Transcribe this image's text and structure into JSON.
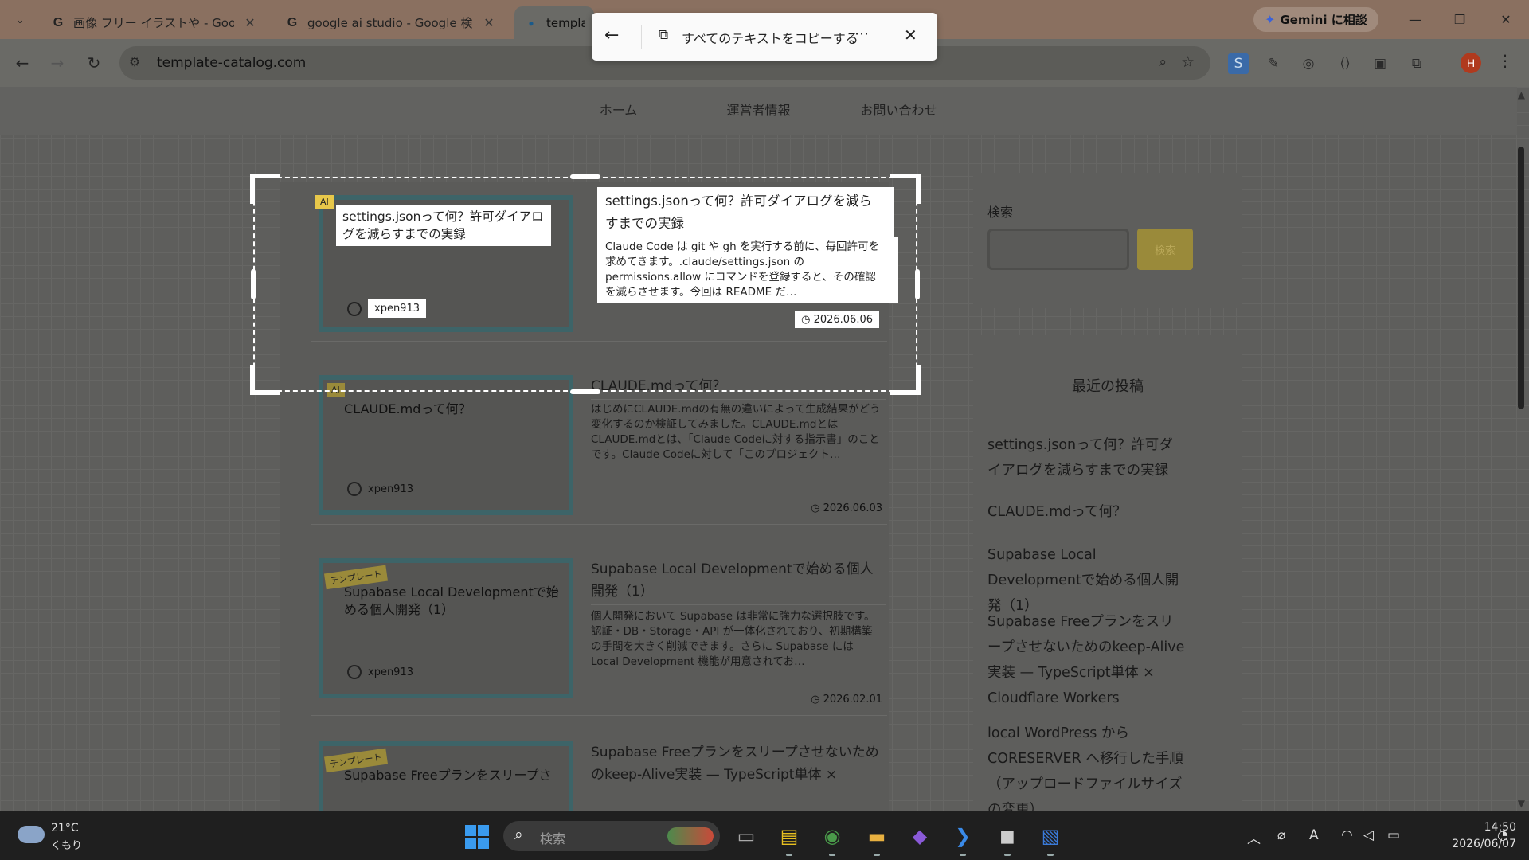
{
  "browser": {
    "tabs": [
      {
        "title": "画像 フリー イラストや - Google 検",
        "icon": "G"
      },
      {
        "title": "google ai studio - Google 検索",
        "icon": "G"
      },
      {
        "title": "template",
        "icon": "●"
      }
    ],
    "gemini_label": "Gemini に相談",
    "url": "template-catalog.com"
  },
  "capture_bar": {
    "copy_label": "すべてのテキストをコピーする"
  },
  "site_nav": [
    "ホーム",
    "運営者情報",
    "お問い合わせ"
  ],
  "posts": [
    {
      "category": "AI",
      "thumb_title": "settings.jsonって何？許可ダイアログを減らすまでの実録",
      "author": "xpen913",
      "title_line1": "settings.jsonって何？許可ダイアログを減ら",
      "title_line2": "すまでの実録",
      "excerpt": [
        "Claude Code は git や gh を実行する前に、毎回許可を",
        "求めてきます。.claude/settings.json の",
        "permissions.allow にコマンドを登録すると、その確認",
        "を減らさせます。今回は README だ…"
      ],
      "date": "2026.06.06"
    },
    {
      "category": "AI",
      "thumb_title": "CLAUDE.mdって何？",
      "author": "xpen913",
      "title": "CLAUDE.mdって何？",
      "excerpt": "はじめにCLAUDE.mdの有無の違いによって生成結果がどう変化するのか検証してみました。CLAUDE.mdとはCLAUDE.mdとは、「Claude Codeに対する指示書」のことです。Claude Codeに対して「このプロジェクト…",
      "date": "2026.06.03"
    },
    {
      "category": "テンプレート",
      "thumb_title": "Supabase Local Developmentで始める個人開発（1）",
      "author": "xpen913",
      "title": "Supabase Local Developmentで始める個人開発（1）",
      "excerpt": "個人開発において Supabase は非常に強力な選択肢です。認証・DB・Storage・API が一体化されており、初期構築の手間を大きく削減できます。さらに Supabase には Local Development 機能が用意されてお…",
      "date": "2026.02.01"
    },
    {
      "category": "テンプレート",
      "thumb_title": "Supabase Freeプランをスリープさ",
      "title": "Supabase Freeプランをスリープさせないためのkeep-Alive実装 — TypeScript単体 ×"
    }
  ],
  "sidebar": {
    "search_label": "検索",
    "search_button": "検索",
    "recent_heading": "最近の投稿",
    "recent": [
      "settings.jsonって何？許可ダイアログを減らすまでの実録",
      "CLAUDE.mdって何？",
      "Supabase Local Developmentで始める個人開発（1）",
      "Supabase Freeプランをスリープさせないためのkeep-Alive実装 — TypeScript単体 × Cloudflare Workers",
      "local WordPress から CORESERVER へ移行した手順（アップロードファイルサイズの変更）"
    ]
  },
  "taskbar": {
    "temp": "21°C",
    "weather": "くもり",
    "search_placeholder": "検索",
    "time": "14:50",
    "date": "2026/06/07"
  },
  "colors": {
    "accent_tag": "#9a8a3a",
    "thumb_border": "#3d6468",
    "avatar": "#b03a1e"
  }
}
